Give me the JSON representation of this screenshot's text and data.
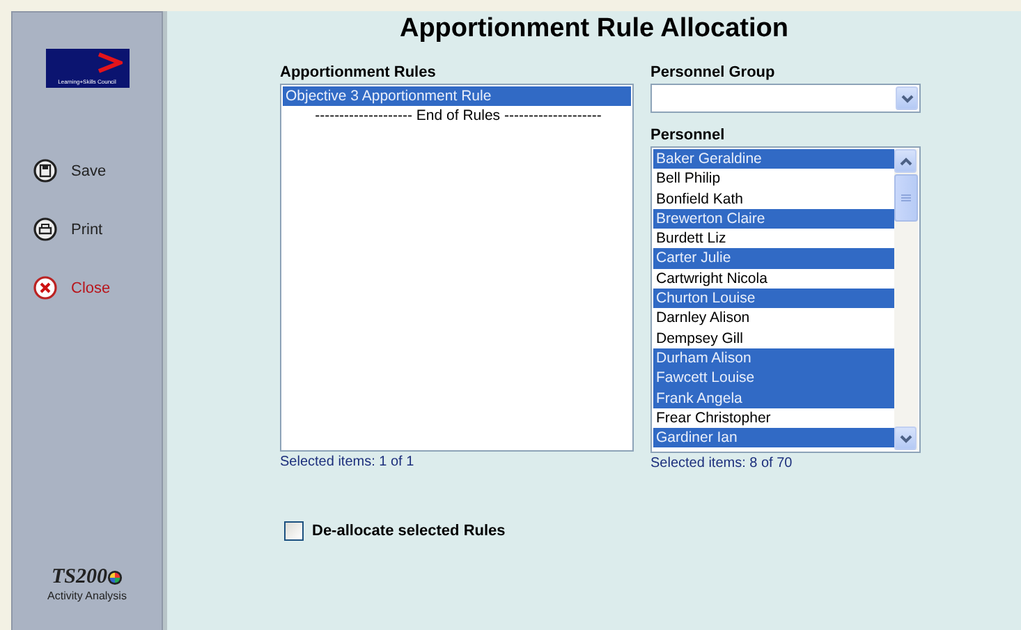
{
  "sidebar": {
    "logo_text": "Learning+Skills Council",
    "actions": [
      {
        "kind": "save",
        "label": "Save"
      },
      {
        "kind": "print",
        "label": "Print"
      },
      {
        "kind": "close",
        "label": "Close"
      }
    ],
    "product": {
      "name": "TS200",
      "subtitle": "Activity Analysis"
    }
  },
  "title": "Apportionment Rule Allocation",
  "rules": {
    "label": "Apportionment Rules",
    "items": [
      {
        "text": "Objective 3 Apportionment Rule",
        "selected": true
      },
      {
        "text": "-------------------- End of Rules --------------------",
        "selected": false
      }
    ],
    "status": "Selected items: 1 of 1"
  },
  "personnel_group": {
    "label": "Personnel Group"
  },
  "personnel": {
    "label": "Personnel",
    "items": [
      {
        "text": "Baker Geraldine",
        "selected": true
      },
      {
        "text": "Bell Philip",
        "selected": false
      },
      {
        "text": "Bonfield Kath",
        "selected": false
      },
      {
        "text": "Brewerton Claire",
        "selected": true
      },
      {
        "text": "Burdett Liz",
        "selected": false
      },
      {
        "text": "Carter Julie",
        "selected": true
      },
      {
        "text": "Cartwright Nicola",
        "selected": false
      },
      {
        "text": "Churton Louise",
        "selected": true
      },
      {
        "text": "Darnley Alison",
        "selected": false
      },
      {
        "text": "Dempsey Gill",
        "selected": false
      },
      {
        "text": "Durham Alison",
        "selected": true
      },
      {
        "text": "Fawcett Louise",
        "selected": true
      },
      {
        "text": "Frank Angela",
        "selected": true
      },
      {
        "text": "Frear Christopher",
        "selected": false
      },
      {
        "text": "Gardiner Ian",
        "selected": true
      }
    ],
    "status": "Selected items: 8 of 70"
  },
  "deallocate": {
    "label": "De-allocate selected Rules",
    "checked": false
  }
}
